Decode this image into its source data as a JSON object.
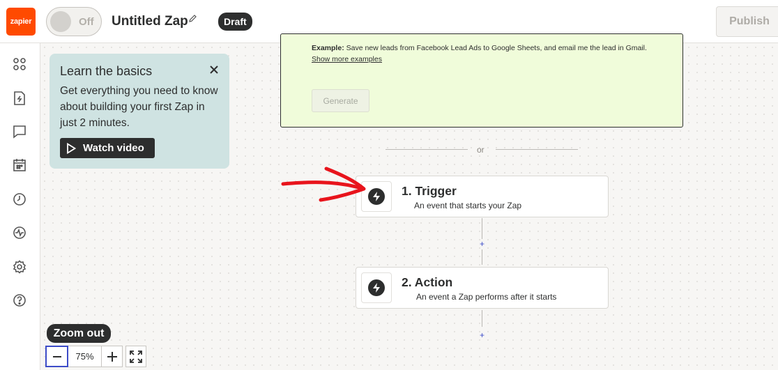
{
  "header": {
    "logo_text": "zapier",
    "toggle_label": "Off",
    "zap_title": "Untitled Zap",
    "status_badge": "Draft",
    "publish_label": "Publish"
  },
  "sidebar": {
    "icons": [
      "apps-icon",
      "zap-file-icon",
      "comment-icon",
      "calendar-icon",
      "history-icon",
      "activity-icon",
      "settings-icon",
      "help-icon"
    ]
  },
  "learn_card": {
    "title": "Learn the basics",
    "body": "Get everything you need to know about building your first Zap in just 2 minutes.",
    "watch_label": "Watch video"
  },
  "ai_box": {
    "example_label": "Example:",
    "example_text": " Save new leads from Facebook Lead Ads to Google Sheets, and email me the lead in Gmail.",
    "more_link": "Show more examples",
    "generate_label": "Generate"
  },
  "divider_text": "or",
  "steps": [
    {
      "title": "1. Trigger",
      "description": "An event that starts your Zap"
    },
    {
      "title": "2. Action",
      "description": "An event a Zap performs after it starts"
    }
  ],
  "add_step_label": "+",
  "zoom": {
    "tooltip": "Zoom out",
    "value": "75%"
  },
  "colors": {
    "brand": "#ff4a00",
    "accent": "#3d4cc8",
    "annotation_arrow": "#e8141c"
  }
}
